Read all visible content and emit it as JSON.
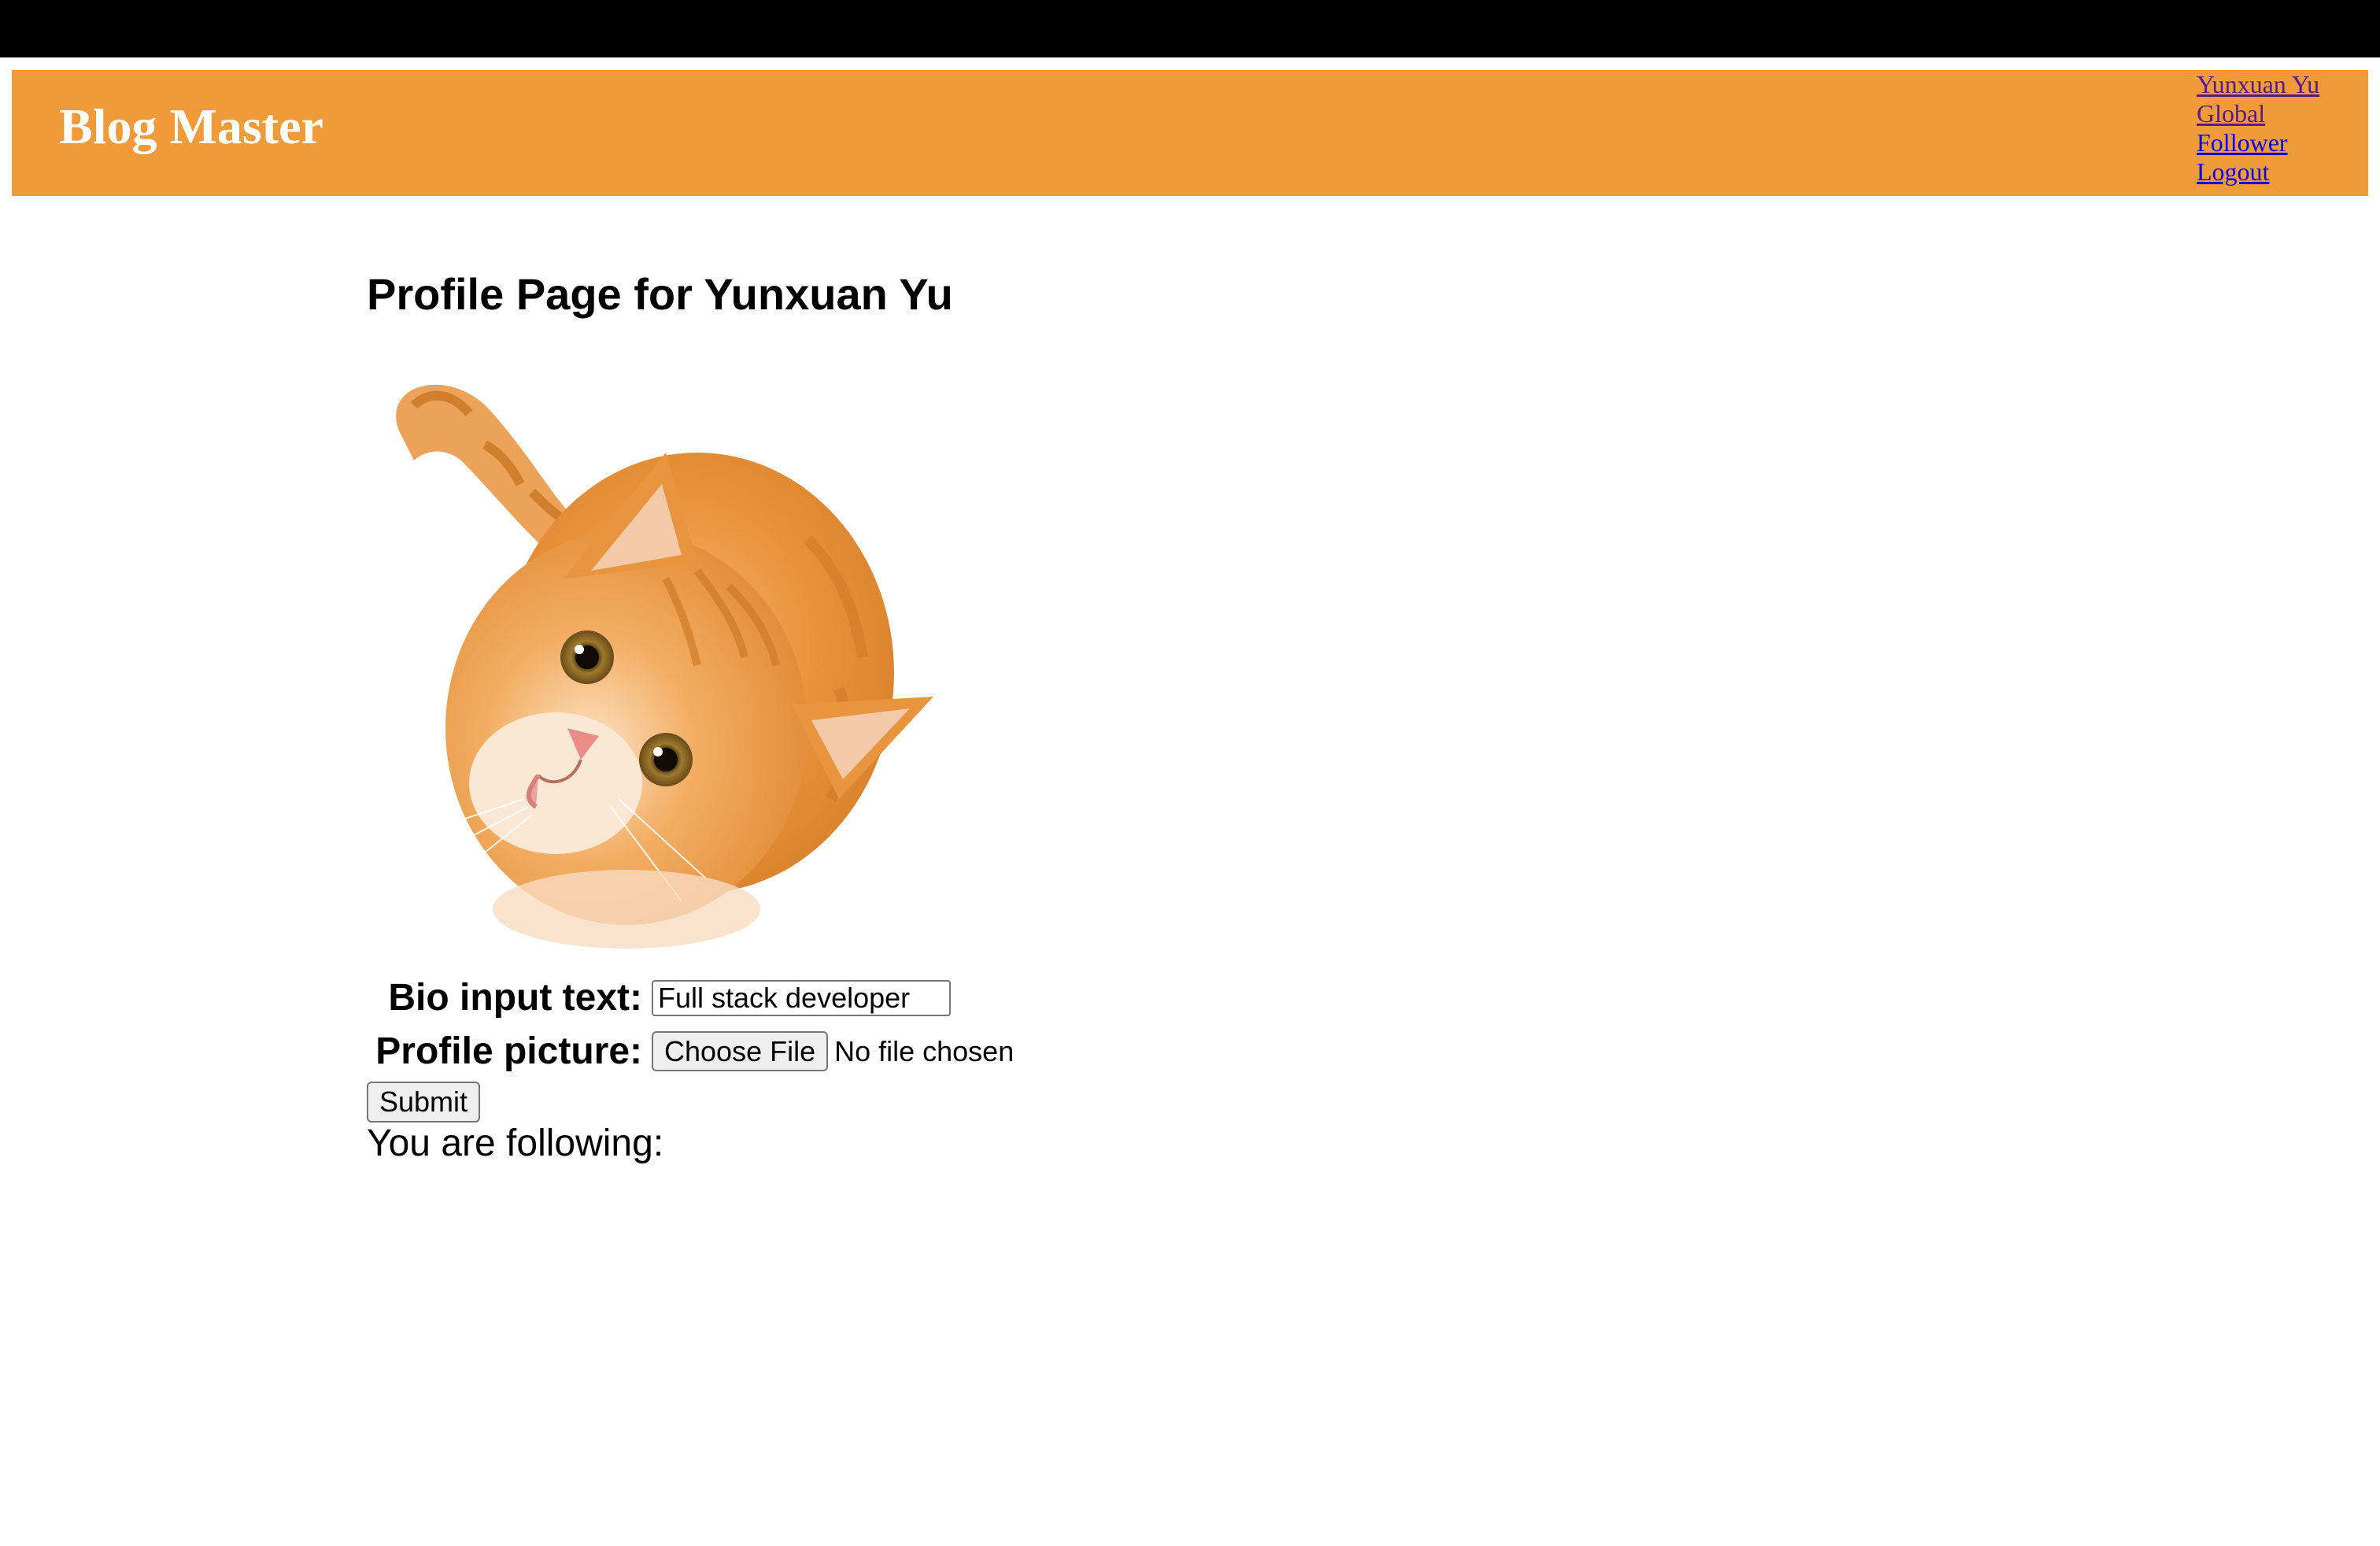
{
  "header": {
    "title": "Blog Master",
    "nav": [
      {
        "label": "Yunxuan Yu",
        "visited": true
      },
      {
        "label": "Global",
        "visited": true
      },
      {
        "label": "Follower",
        "visited": false
      },
      {
        "label": "Logout",
        "visited": false
      }
    ],
    "background_color": "#f19a3a"
  },
  "profile": {
    "title": "Profile Page for Yunxuan Yu",
    "avatar_icon": "orange-cat-photo"
  },
  "form": {
    "bio_label": "Bio input text:",
    "bio_value": "Full stack developer",
    "picture_label": "Profile picture:",
    "choose_file_label": "Choose File",
    "file_status": "No file chosen",
    "submit_label": "Submit"
  },
  "following": {
    "label": "You are following:"
  }
}
